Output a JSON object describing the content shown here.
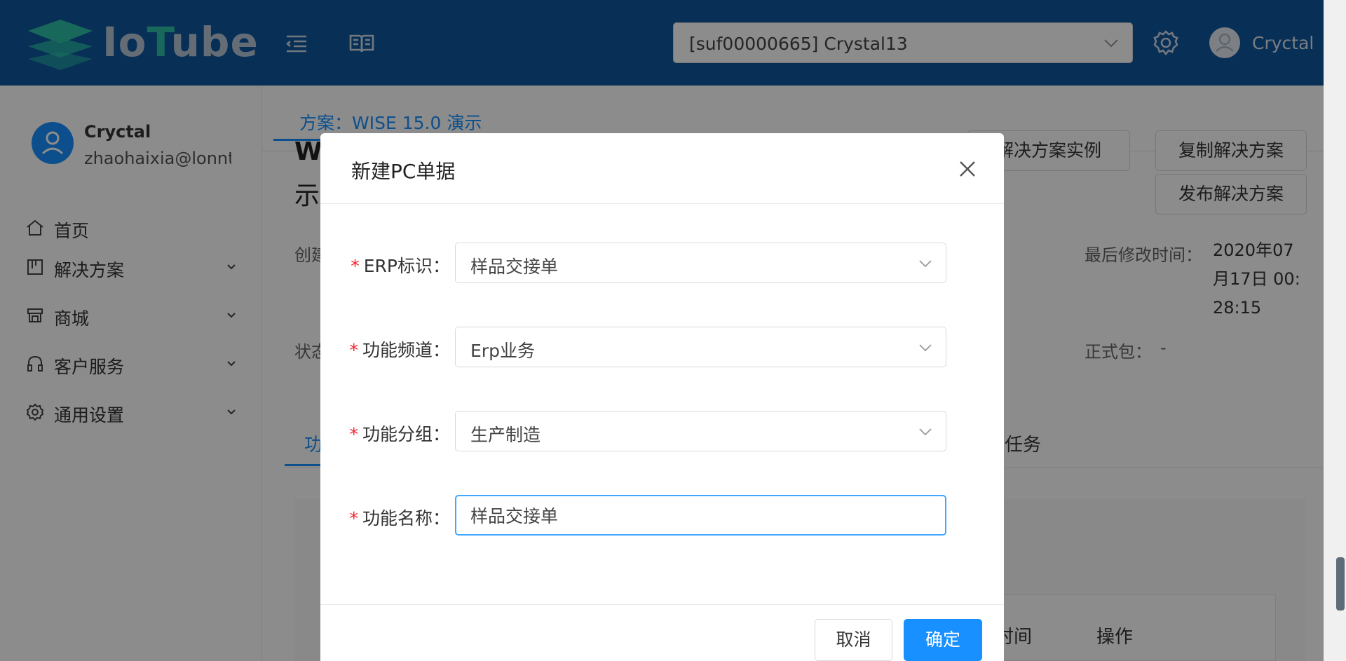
{
  "header": {
    "logo_text_a": "Io",
    "logo_text_b": "T",
    "logo_text_c": "ube",
    "tenant": "[suf00000665] Crystal13",
    "username": "Cryctal"
  },
  "sidebar": {
    "name": "Cryctal",
    "email": "zhaohaixia@lonntec",
    "items": [
      {
        "label": "首页",
        "icon": "home-icon"
      },
      {
        "label": "解决方案",
        "icon": "solution-icon"
      },
      {
        "label": "商城",
        "icon": "shop-icon"
      },
      {
        "label": "客户服务",
        "icon": "headset-icon"
      },
      {
        "label": "通用设置",
        "icon": "gear-icon"
      }
    ]
  },
  "main": {
    "scheme_tab": "方案：WISE 15.0 演示",
    "title_a": "W",
    "title_b": "示",
    "btn_instance": "解决方案实例",
    "btn_copy": "复制解决方案",
    "btn_publish": "发布解决方案",
    "created_label": "创建",
    "modified_label": "最后修改时间：",
    "modified_value_1": "2020年07",
    "modified_value_2": "月17日 00:",
    "modified_value_3": "28:15",
    "status_label": "状态",
    "release_label": "正式包：",
    "release_value": "-",
    "tab_active": "功",
    "tab_task": "任务",
    "col_time": "时间",
    "col_action": "操作"
  },
  "modal": {
    "title": "新建PC单据",
    "fields": [
      {
        "label": "ERP标识：",
        "value": "样品交接单"
      },
      {
        "label": "功能频道：",
        "value": "Erp业务"
      },
      {
        "label": "功能分组：",
        "value": "生产制造"
      },
      {
        "label": "功能名称：",
        "value": "样品交接单"
      }
    ],
    "required_mark": "*",
    "cancel": "取消",
    "ok": "确定"
  },
  "colors": {
    "header_bg": "#0f579c",
    "primary": "#1890ff",
    "required": "#f5222d",
    "logo_accent": "#2cc0a8"
  }
}
